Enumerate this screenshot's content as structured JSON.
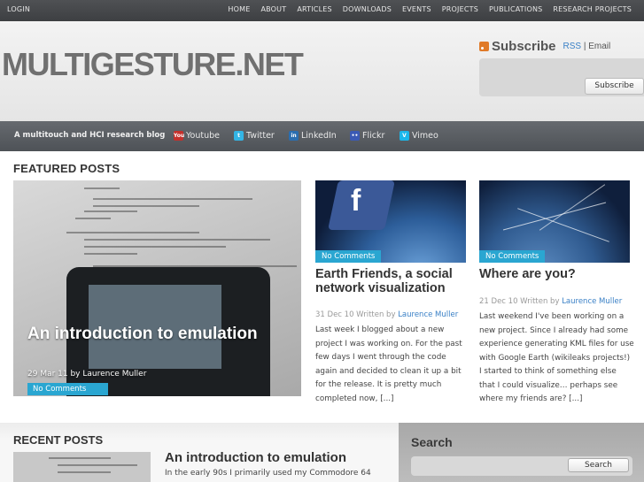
{
  "topnav": {
    "login": "LOGIN",
    "items": [
      "HOME",
      "ABOUT",
      "ARTICLES",
      "DOWNLOADS",
      "EVENTS",
      "PROJECTS",
      "PUBLICATIONS",
      "RESEARCH PROJECTS"
    ]
  },
  "header": {
    "logo": "MULTIGESTURE.NET",
    "subscribe_title": "Subscribe",
    "subscribe_rss": "RSS",
    "subscribe_sep": " | ",
    "subscribe_email": "Email",
    "subscribe_button": "Subscribe"
  },
  "social": {
    "tagline": "A multitouch and HCI research blog",
    "links": [
      {
        "label": "Youtube",
        "icon": "youtube-icon",
        "color": "#c4302b",
        "glyph": "You"
      },
      {
        "label": "Twitter",
        "icon": "twitter-icon",
        "color": "#33b5e5",
        "glyph": "t"
      },
      {
        "label": "LinkedIn",
        "icon": "linkedin-icon",
        "color": "#2a6eb0",
        "glyph": "in"
      },
      {
        "label": "Flickr",
        "icon": "flickr-icon",
        "color": "#3b5ab5",
        "glyph": "••"
      },
      {
        "label": "Vimeo",
        "icon": "vimeo-icon",
        "color": "#1ab7ea",
        "glyph": "V"
      }
    ]
  },
  "featured": {
    "heading": "FEATURED POSTS",
    "main": {
      "title": "An introduction to emulation",
      "meta": "29 Mar 11 by Laurence Muller",
      "badge": "No Comments"
    },
    "posts": [
      {
        "badge": "No Comments",
        "title": "Earth Friends, a social network visualization",
        "date": "31 Dec 10 Written by ",
        "author": "Laurence Muller",
        "text": "Last week I blogged about a new project I was working on. For the past few days I went through the code again and decided to clean it up a bit for the release. It is pretty much completed now, [...]"
      },
      {
        "badge": "No Comments",
        "title": "Where are you?",
        "date": "21 Dec 10 Written by ",
        "author": "Laurence Muller",
        "text": "Last weekend I've been working on a new project. Since I already had some experience  generating KML files for use with Google Earth (wikileaks projects!) I started to think of something else that I could visualize… perhaps see where my friends are? [...]"
      }
    ]
  },
  "recent": {
    "heading": "RECENT POSTS",
    "title": "An introduction to emulation",
    "text": "In the early 90s I primarily used my Commodore 64"
  },
  "search": {
    "heading": "Search",
    "button": "Search"
  }
}
